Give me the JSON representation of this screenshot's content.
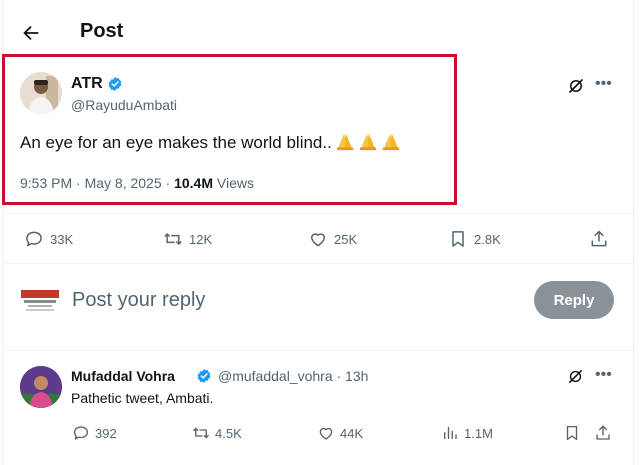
{
  "header": {
    "title": "Post"
  },
  "post": {
    "author_name": "ATR",
    "author_handle": "@RayuduAmbati",
    "text": "An eye for an eye makes the world blind..",
    "emojis": [
      "folded-hands",
      "folded-hands",
      "folded-hands"
    ],
    "time": "9:53 PM · May 8, 2025 · ",
    "views_count": "10.4M",
    "views_label": " Views",
    "stats": {
      "replies": "33K",
      "reposts": "12K",
      "likes": "25K",
      "bookmarks": "2.8K"
    }
  },
  "reply_box": {
    "placeholder": "Post your reply",
    "button_label": "Reply"
  },
  "reply": {
    "author_name": "Mufaddal Vohra",
    "author_handle": "@mufaddal_vohra · 13h",
    "text": "Pathetic tweet, Ambati.",
    "stats": {
      "replies": "392",
      "reposts": "4.5K",
      "likes": "44K",
      "views": "1.1M"
    }
  },
  "colors": {
    "accent": "#1d9bf0",
    "highlight_border": "#c8102e",
    "reply_button": "#8b9297",
    "muted_text": "#536471"
  },
  "icons": [
    "back-arrow-icon",
    "verified-badge-icon",
    "grok-icon",
    "more-icon",
    "reply-icon",
    "repost-icon",
    "like-icon",
    "bookmark-icon",
    "share-icon",
    "views-icon"
  ]
}
